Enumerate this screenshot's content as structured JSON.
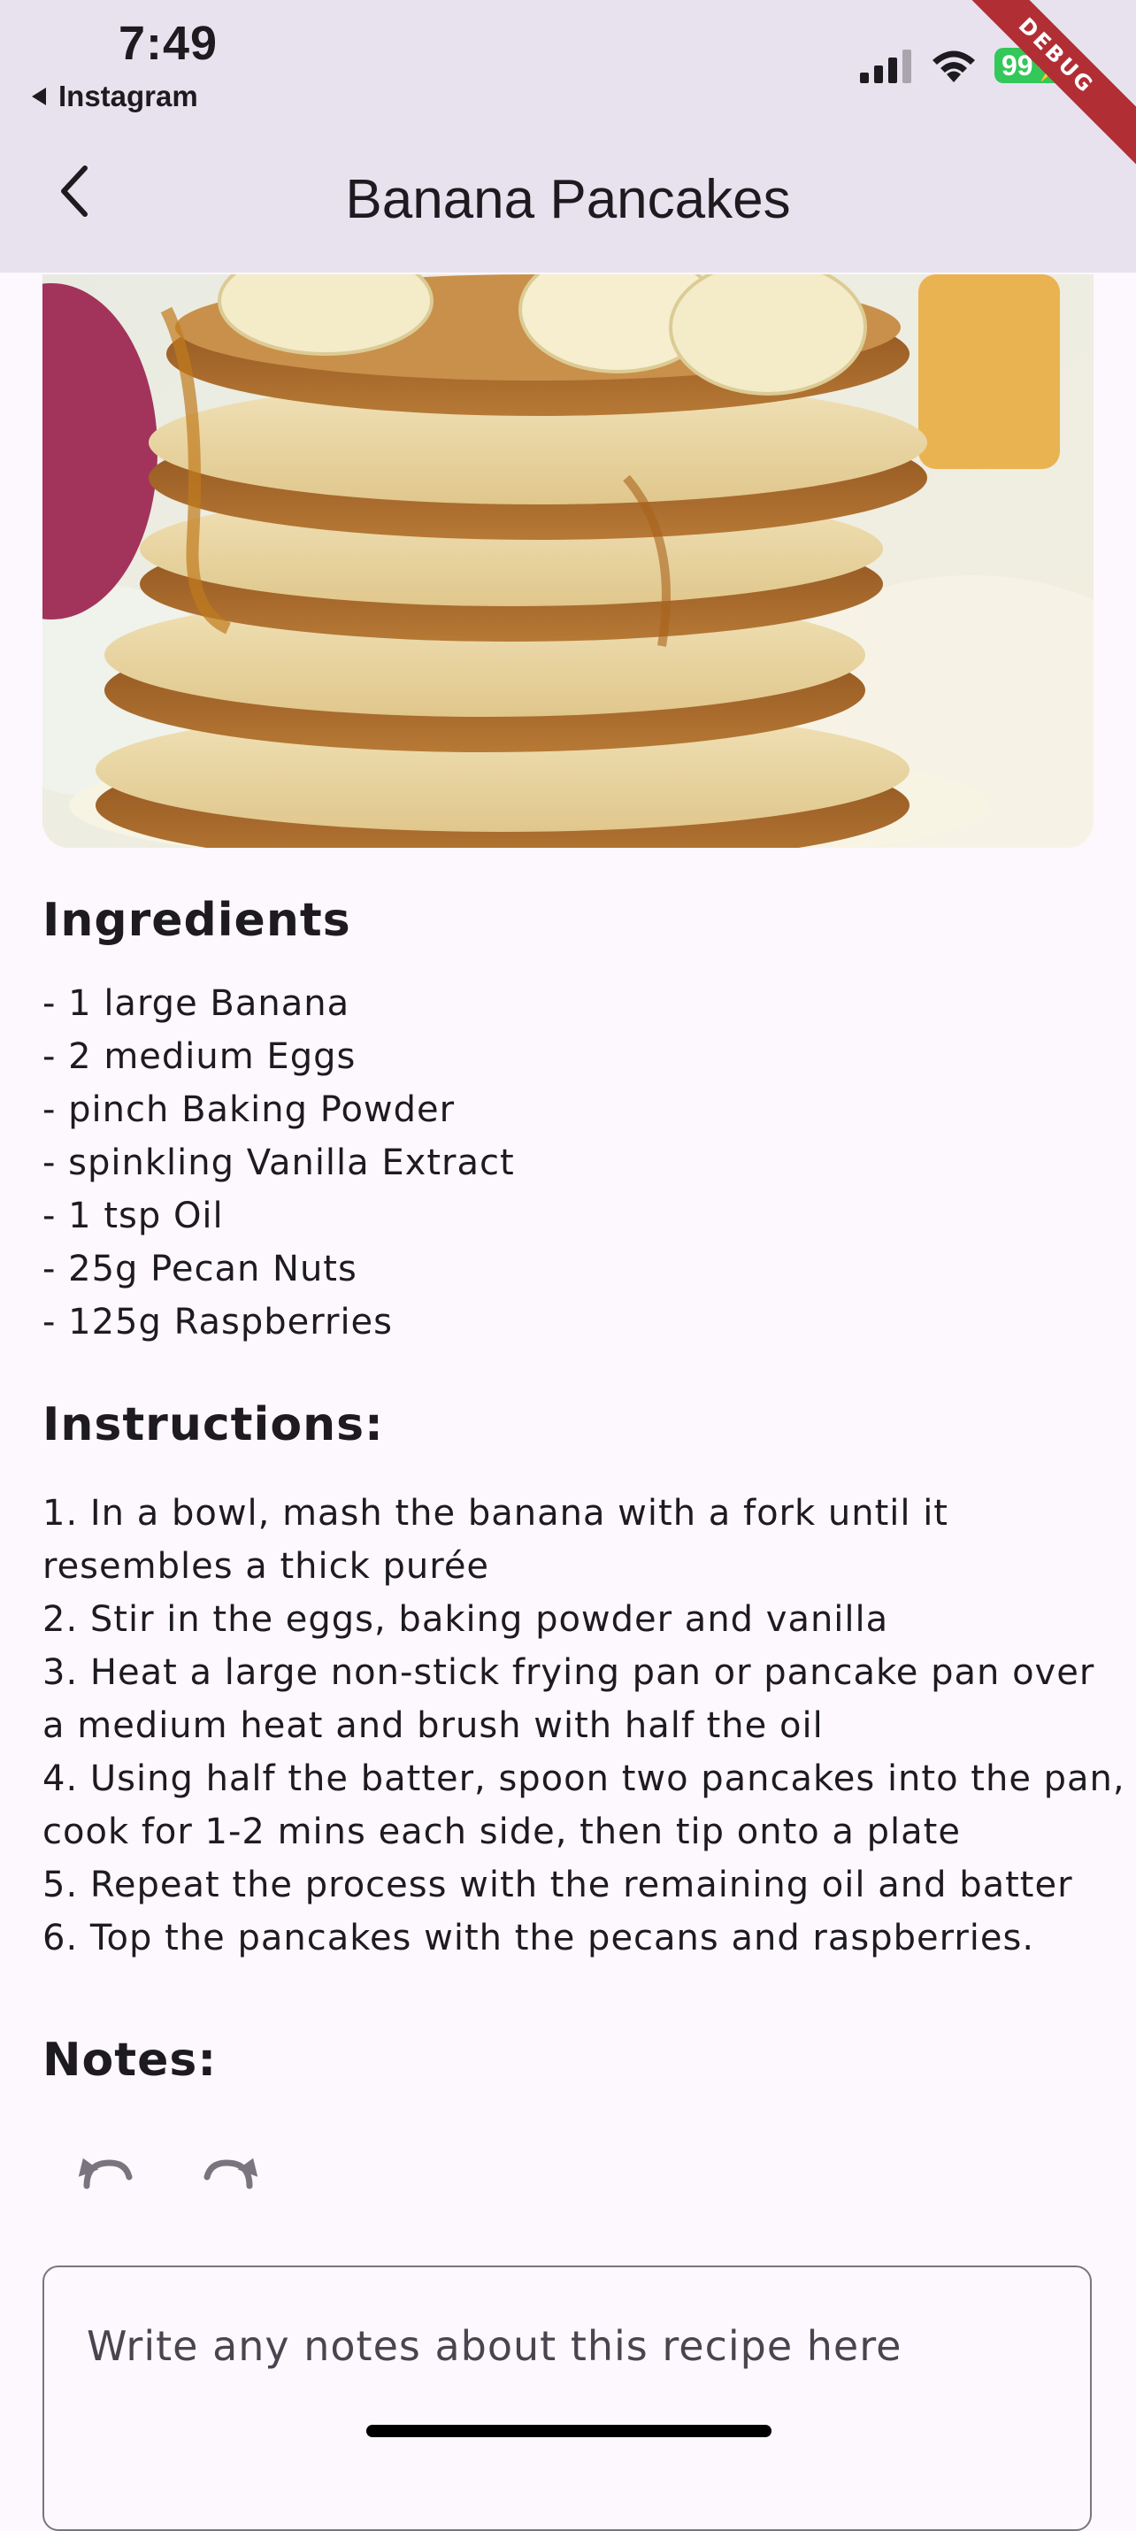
{
  "status_bar": {
    "time": "7:49",
    "back_app": "Instagram",
    "battery": "99",
    "debug_banner": "DEBUG"
  },
  "app_bar": {
    "title": "Banana Pancakes"
  },
  "ingredients": {
    "heading": "Ingredients",
    "items": [
      "- 1 large Banana",
      "- 2 medium Eggs",
      "- pinch Baking Powder",
      "- spinkling Vanilla Extract",
      "- 1 tsp Oil",
      "- 25g Pecan Nuts",
      "- 125g Raspberries"
    ]
  },
  "instructions": {
    "heading": "Instructions:",
    "lines": [
      "1. In a bowl, mash the banana with a fork until it",
      "resembles a thick purée",
      "2. Stir in the eggs, baking powder and vanilla",
      "3. Heat a large non-stick frying pan or pancake pan over",
      "a medium heat and brush with half the oil",
      "4. Using half the batter, spoon two pancakes into the pan,",
      "cook for 1-2 mins each side, then tip onto a plate",
      "5. Repeat the process with the remaining oil and batter",
      "6. Top the pancakes with the pecans and raspberries."
    ]
  },
  "notes": {
    "heading": "Notes:",
    "placeholder": "Write any notes about this recipe here"
  },
  "colors": {
    "app_bar_bg": "#e8e2ef",
    "page_bg": "#fdf7fe",
    "battery": "#34c759",
    "debug": "#b22e35"
  }
}
